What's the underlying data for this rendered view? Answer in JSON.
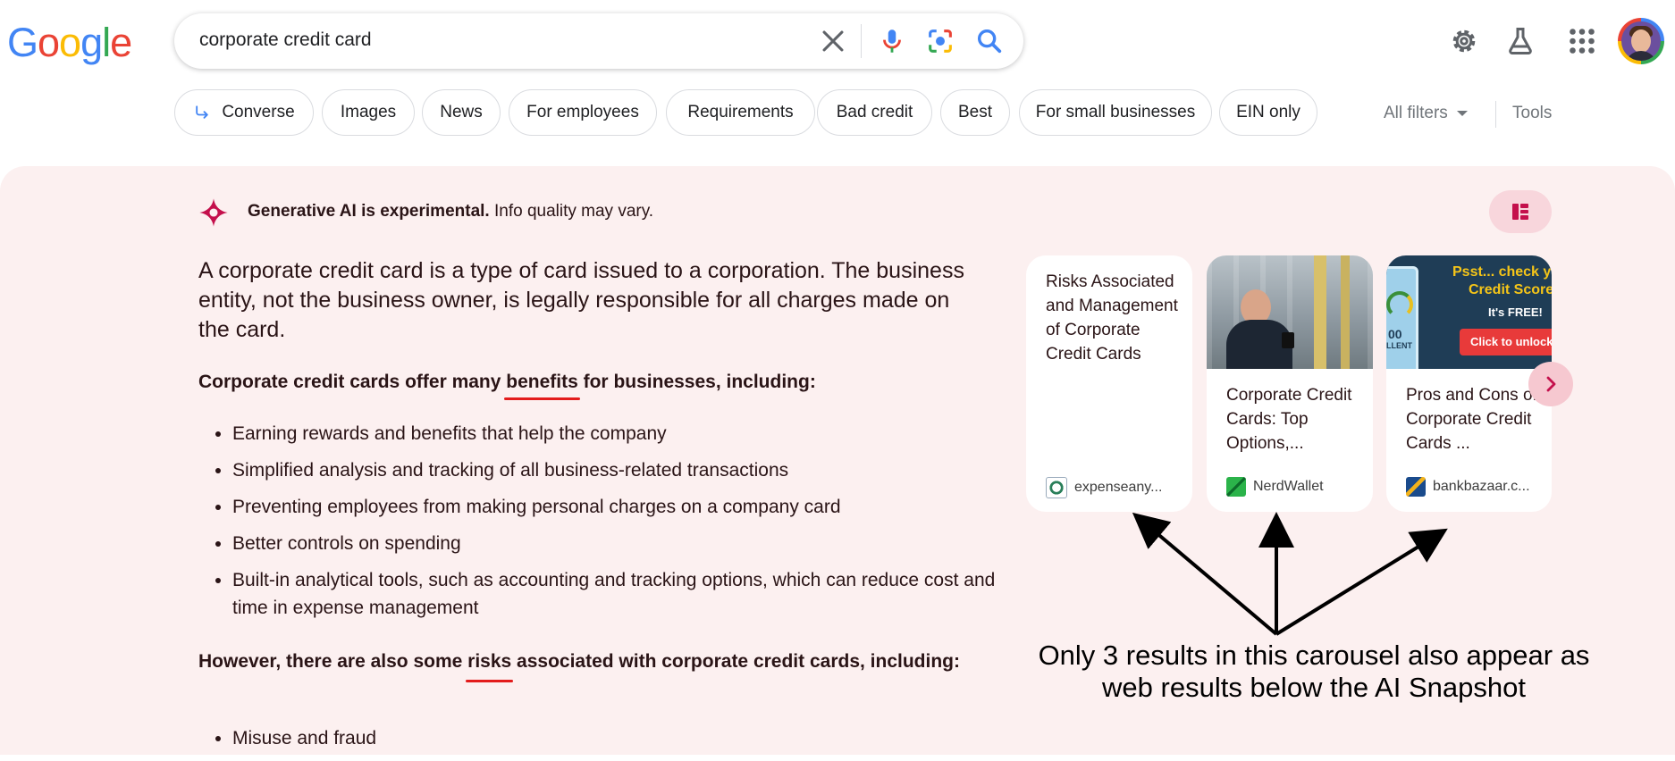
{
  "logo": {
    "text": [
      "G",
      "o",
      "o",
      "g",
      "l",
      "e"
    ],
    "colors": [
      "#4285f4",
      "#ea4335",
      "#fbbc05",
      "#4285f4",
      "#34a853",
      "#ea4335"
    ]
  },
  "search": {
    "query": "corporate credit card"
  },
  "header_icons": [
    "settings-icon",
    "labs-flask-icon",
    "apps-grid-icon",
    "avatar"
  ],
  "chips": [
    {
      "label": "Converse",
      "icon": "converse-arrow-icon"
    },
    {
      "label": "Images"
    },
    {
      "label": "News"
    },
    {
      "label": "For employees"
    },
    {
      "label": "Requirements"
    },
    {
      "label": "Bad credit"
    },
    {
      "label": "Best"
    },
    {
      "label": "For small businesses"
    },
    {
      "label": "EIN only"
    }
  ],
  "filters": {
    "all_filters": "All filters",
    "tools": "Tools"
  },
  "ai": {
    "disclaimer_bold": "Generative AI is experimental.",
    "disclaimer_rest": " Info quality may vary.",
    "summary": "A corporate credit card is a type of card issued to a corporation. The business entity, not the business owner, is legally responsible for all charges made on the card.",
    "benefits_heading": {
      "before": "Corporate credit cards offer many ",
      "word": "benefits",
      "after": " for businesses, including:"
    },
    "benefits": [
      "Earning rewards and benefits that help the company",
      "Simplified analysis and tracking of all business-related transactions",
      "Preventing employees from making personal charges on a company card",
      "Better controls on spending",
      "Built-in analytical tools, such as accounting and tracking options, which can reduce cost and time in expense management"
    ],
    "risks_heading": {
      "before": "However, there are also some ",
      "word": "risks",
      "after": " associated with corporate credit cards, including:"
    },
    "risks": [
      "Misuse and fraud"
    ]
  },
  "carousel": [
    {
      "title": "Risks Associated and Management of Corporate Credit Cards",
      "source": "expenseany..."
    },
    {
      "title": "Corporate Credit Cards: Top Options,...",
      "source": "NerdWallet"
    },
    {
      "title": "Pros and Cons of Corporate Credit Cards ...",
      "source": "bankbazaar.c...",
      "ad": {
        "headline_1": "Psst... check y",
        "headline_2": "Credit Score",
        "free": "It's FREE!",
        "cta": "Click to unlock",
        "badge": "00",
        "badge_sub": "LLENT"
      }
    }
  ],
  "annotation": "Only 3 results in this carousel also appear as web results below the AI Snapshot",
  "colors": {
    "panel_bg": "#fcf0f0",
    "accent_pink": "#f8d6dc",
    "underline_red": "#e31c1c",
    "sge_magenta": "#c4104c"
  }
}
